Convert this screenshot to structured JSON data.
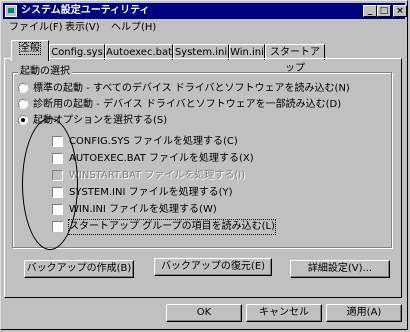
{
  "window": {
    "title": "システム設定ユーティリティ"
  },
  "titlebar_buttons": {
    "minimize": "_",
    "maximize": "□",
    "close": "×"
  },
  "menu": [
    "ファイル(F)",
    "表示(V)",
    "ヘルプ(H)"
  ],
  "tabs": [
    "全般",
    "Config.sys",
    "Autoexec.bat",
    "System.ini",
    "Win.ini",
    "スタートアップ"
  ],
  "startup_group": {
    "label": "起動の選択",
    "radios": [
      {
        "label": "標準の起動 - すべてのデバイス ドライバとソフトウェアを読み込む(N)",
        "selected": false
      },
      {
        "label": "診断用の起動 - デバイス ドライバとソフトウェアを一部読み込む(D)",
        "selected": false
      },
      {
        "label": "起動オプションを選択する(S)",
        "selected": true
      }
    ],
    "checkboxes": [
      {
        "label": "CONFIG.SYS ファイルを処理する(C)",
        "checked": false,
        "enabled": true
      },
      {
        "label": "AUTOEXEC.BAT ファイルを処理する(X)",
        "checked": false,
        "enabled": true
      },
      {
        "label": "WINSTART.BAT ファイルを処理する(I)",
        "checked": false,
        "enabled": false
      },
      {
        "label": "SYSTEM.INI ファイルを処理する(Y)",
        "checked": false,
        "enabled": true
      },
      {
        "label": "WIN.INI ファイルを処理する(W)",
        "checked": false,
        "enabled": true
      },
      {
        "label": "スタートアップ グループの項目を読み込む(L)",
        "checked": false,
        "enabled": true
      }
    ]
  },
  "panel_buttons": {
    "create_backup": "バックアップの作成(B)",
    "restore_backup": "バックアップの復元(E)",
    "advanced": "詳細設定(V)..."
  },
  "dialog_buttons": {
    "ok": "OK",
    "cancel": "キャンセル",
    "apply": "適用(A)"
  }
}
